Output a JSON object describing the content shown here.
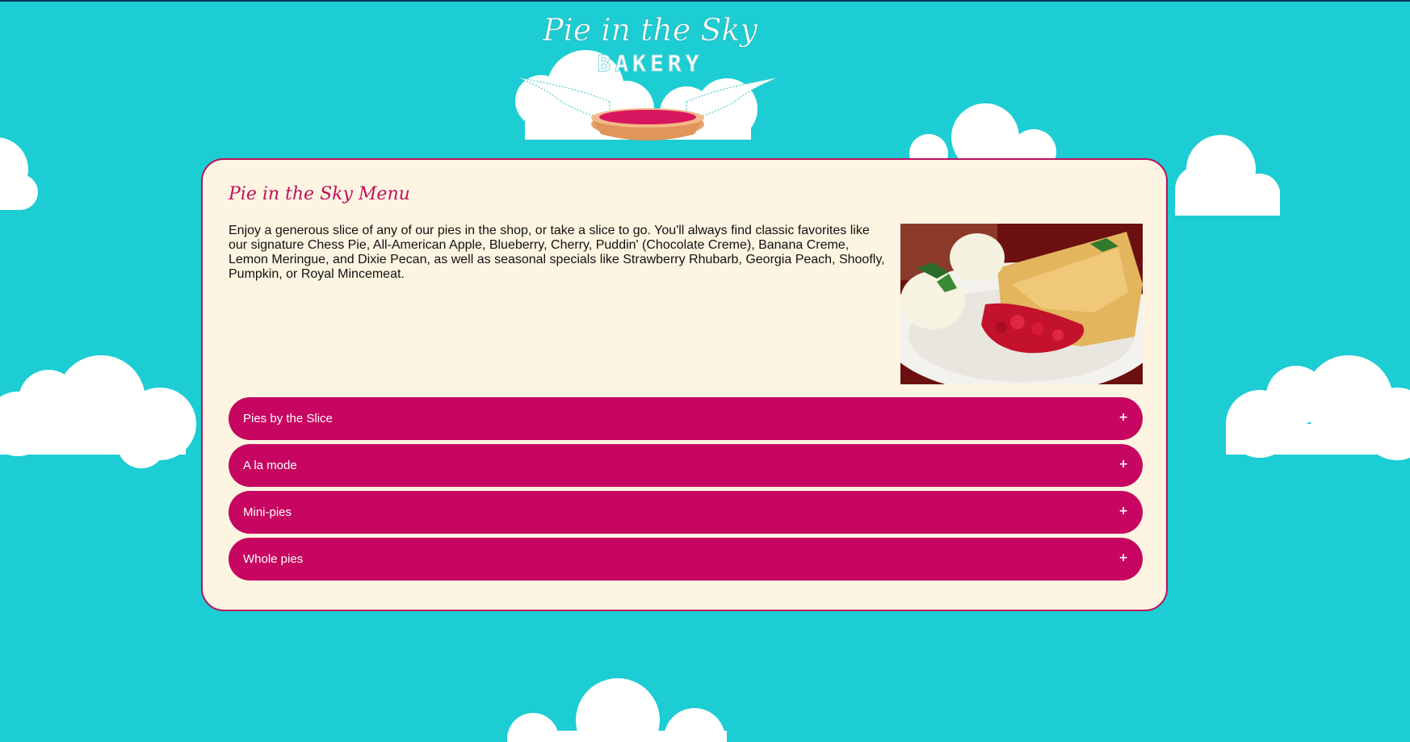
{
  "logo": {
    "script_text": "Pie in the Sky",
    "bakery_text": "BAKERY"
  },
  "menu": {
    "title": "Pie in the Sky Menu",
    "intro": "Enjoy a generous slice of any of our pies in the shop, or take a slice to go. You'll always find classic favorites like our signature Chess Pie, All-American Apple, Blueberry, Cherry, Puddin' (Chocolate Creme), Banana Creme, Lemon Meringue, and Dixie Pecan, as well as seasonal specials like Strawberry Rhubarb, Georgia Peach, Shoofly, Pumpkin, or Royal Mincemeat.",
    "image_subject": "cherry-pie-slice-with-ice-cream",
    "sections": [
      {
        "label": "Pies by the Slice",
        "toggle": "+"
      },
      {
        "label": "A la mode",
        "toggle": "+"
      },
      {
        "label": "Mini-pies",
        "toggle": "+"
      },
      {
        "label": "Whole pies",
        "toggle": "+"
      }
    ]
  },
  "colors": {
    "background": "#1ccdd3",
    "panel": "#fdf5e2",
    "accent": "#c60660",
    "title": "#c0105e"
  }
}
